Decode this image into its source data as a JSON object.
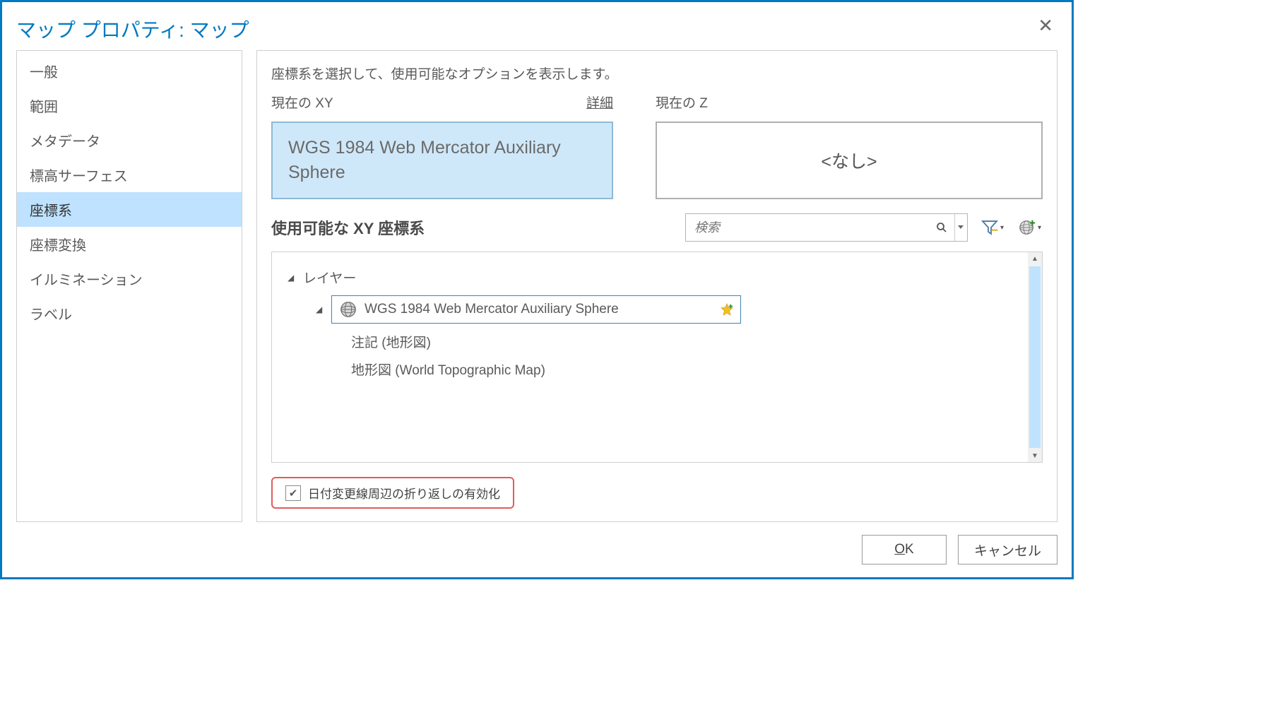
{
  "title": "マップ プロパティ: マップ",
  "sidebar": {
    "items": [
      {
        "label": "一般"
      },
      {
        "label": "範囲"
      },
      {
        "label": "メタデータ"
      },
      {
        "label": "標高サーフェス"
      },
      {
        "label": "座標系"
      },
      {
        "label": "座標変換"
      },
      {
        "label": "イルミネーション"
      },
      {
        "label": "ラベル"
      }
    ]
  },
  "main": {
    "instruction": "座標系を選択して、使用可能なオプションを表示します。",
    "xy_label": "現在の XY",
    "detail_link": "詳細",
    "z_label": "現在の Z",
    "xy_value": "WGS 1984 Web Mercator Auxiliary Sphere",
    "z_value": "<なし>",
    "available_label": "使用可能な XY 座標系",
    "search_placeholder": "検索",
    "tree": {
      "root_label": "レイヤー",
      "selected_label": "WGS 1984 Web Mercator Auxiliary Sphere",
      "child1": "注記 (地形図)",
      "child2": "地形図 (World Topographic Map)"
    },
    "wrap_checkbox_label": "日付変更線周辺の折り返しの有効化"
  },
  "footer": {
    "ok_underline": "O",
    "ok_rest": "K",
    "cancel": "キャンセル"
  }
}
